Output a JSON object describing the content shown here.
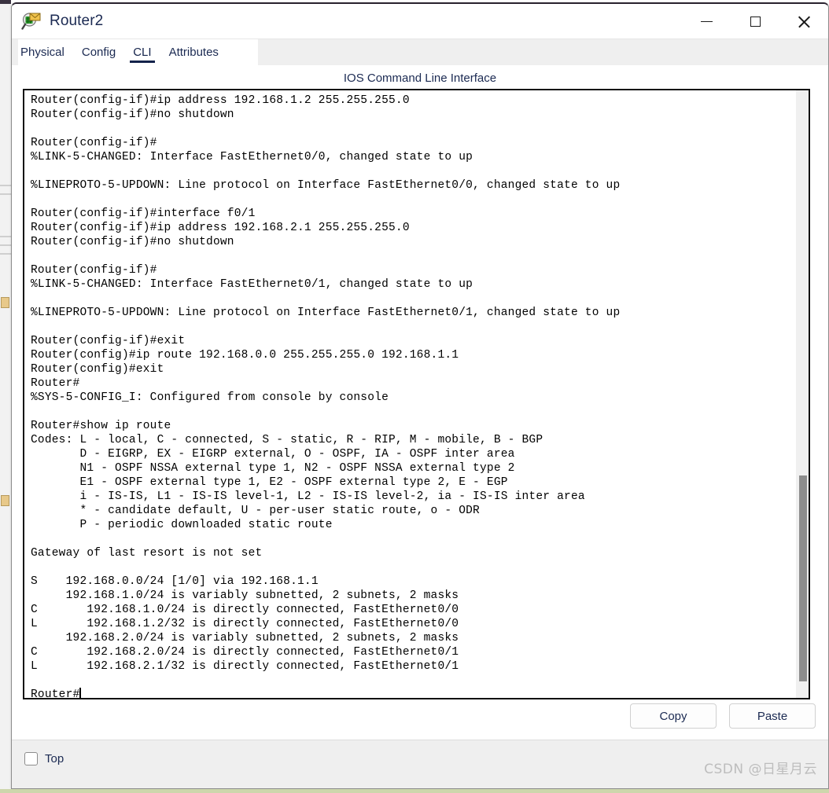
{
  "window": {
    "title": "Router2",
    "icon": "router-magnifier-icon",
    "controls": {
      "minimize": "minimize-icon",
      "maximize": "maximize-icon",
      "close": "close-icon"
    }
  },
  "tabs": [
    {
      "label": "Physical",
      "active": false
    },
    {
      "label": "Config",
      "active": false
    },
    {
      "label": "CLI",
      "active": true
    },
    {
      "label": "Attributes",
      "active": false
    }
  ],
  "cli": {
    "heading": "IOS Command Line Interface",
    "lines": [
      "Router(config-if)#ip address 192.168.1.2 255.255.255.0",
      "Router(config-if)#no shutdown",
      "",
      "Router(config-if)#",
      "%LINK-5-CHANGED: Interface FastEthernet0/0, changed state to up",
      "",
      "%LINEPROTO-5-UPDOWN: Line protocol on Interface FastEthernet0/0, changed state to up",
      "",
      "Router(config-if)#interface f0/1",
      "Router(config-if)#ip address 192.168.2.1 255.255.255.0",
      "Router(config-if)#no shutdown",
      "",
      "Router(config-if)#",
      "%LINK-5-CHANGED: Interface FastEthernet0/1, changed state to up",
      "",
      "%LINEPROTO-5-UPDOWN: Line protocol on Interface FastEthernet0/1, changed state to up",
      "",
      "Router(config-if)#exit",
      "Router(config)#ip route 192.168.0.0 255.255.255.0 192.168.1.1",
      "Router(config)#exit",
      "Router#",
      "%SYS-5-CONFIG_I: Configured from console by console",
      "",
      "Router#show ip route",
      "Codes: L - local, C - connected, S - static, R - RIP, M - mobile, B - BGP",
      "       D - EIGRP, EX - EIGRP external, O - OSPF, IA - OSPF inter area",
      "       N1 - OSPF NSSA external type 1, N2 - OSPF NSSA external type 2",
      "       E1 - OSPF external type 1, E2 - OSPF external type 2, E - EGP",
      "       i - IS-IS, L1 - IS-IS level-1, L2 - IS-IS level-2, ia - IS-IS inter area",
      "       * - candidate default, U - per-user static route, o - ODR",
      "       P - periodic downloaded static route",
      "",
      "Gateway of last resort is not set",
      "",
      "S    192.168.0.0/24 [1/0] via 192.168.1.1",
      "     192.168.1.0/24 is variably subnetted, 2 subnets, 2 masks",
      "C       192.168.1.0/24 is directly connected, FastEthernet0/0",
      "L       192.168.1.2/32 is directly connected, FastEthernet0/0",
      "     192.168.2.0/24 is variably subnetted, 2 subnets, 2 masks",
      "C       192.168.2.0/24 is directly connected, FastEthernet0/1",
      "L       192.168.2.1/32 is directly connected, FastEthernet0/1",
      ""
    ],
    "prompt": "Router#"
  },
  "actions": {
    "copy_label": "Copy",
    "paste_label": "Paste"
  },
  "bottom": {
    "top_checkbox_label": "Top",
    "top_checkbox_checked": false,
    "watermark": "CSDN @日星月云"
  },
  "colors": {
    "accent": "#13224a",
    "terminal_border": "#111111",
    "scrollbar_thumb": "#8d8d8d",
    "panel_bg": "#efefef",
    "watermark": "#bdbdbd"
  }
}
